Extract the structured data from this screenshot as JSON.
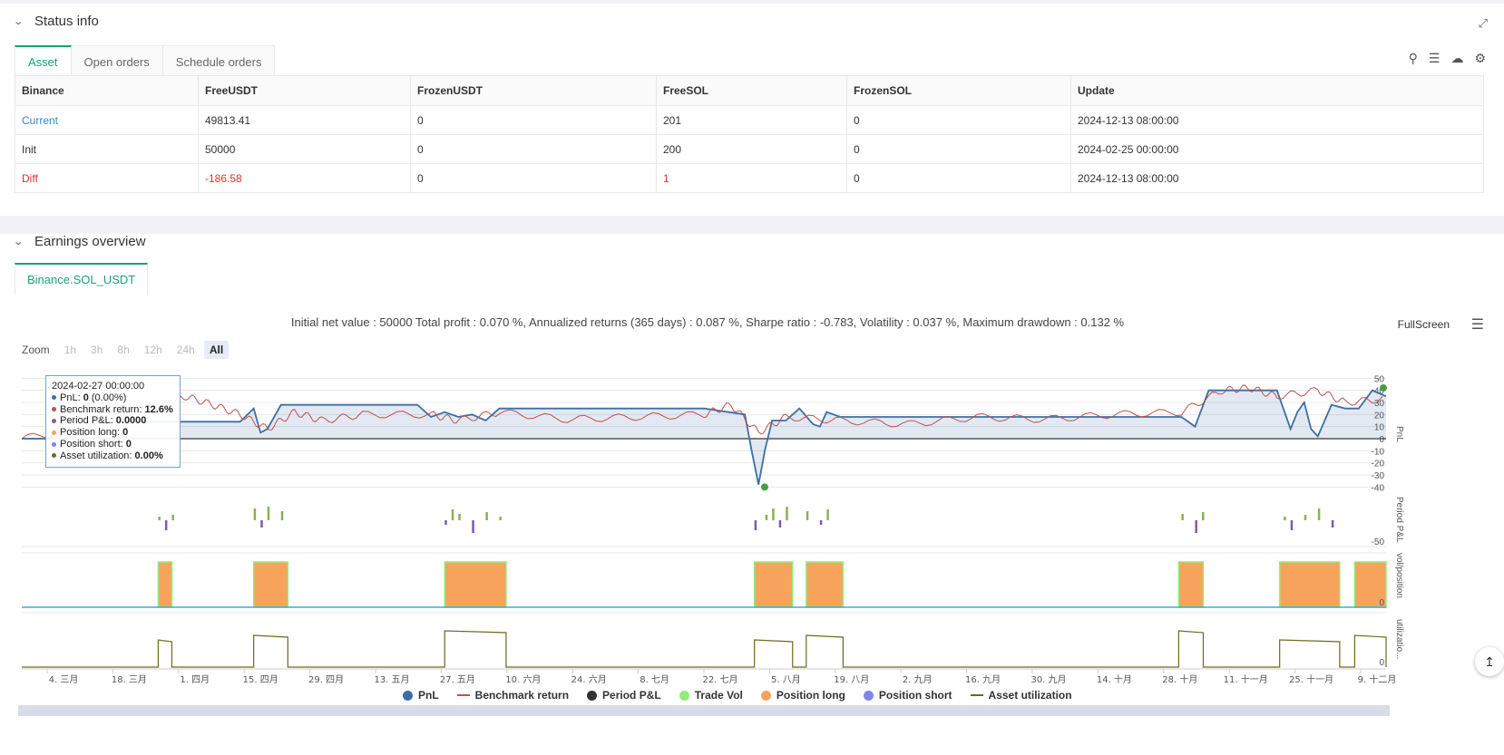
{
  "status": {
    "title": "Status info",
    "tabs": [
      "Asset",
      "Open orders",
      "Schedule orders"
    ],
    "columns": [
      "Binance",
      "FreeUSDT",
      "FrozenUSDT",
      "FreeSOL",
      "FrozenSOL",
      "Update"
    ],
    "rows": [
      {
        "label": "Current",
        "freeusdt": "49813.41",
        "frozenusdt": "0",
        "freesol": "201",
        "frozensol": "0",
        "update": "2024-12-13 08:00:00"
      },
      {
        "label": "Init",
        "freeusdt": "50000",
        "frozenusdt": "0",
        "freesol": "200",
        "frozensol": "0",
        "update": "2024-02-25 00:00:00"
      },
      {
        "label": "Diff",
        "freeusdt": "-186.58",
        "frozenusdt": "0",
        "freesol": "1",
        "frozensol": "0",
        "update": "2024-12-13 08:00:00"
      }
    ]
  },
  "earnings": {
    "title": "Earnings overview",
    "tab": "Binance.SOL_USDT",
    "summary": "Initial net value : 50000 Total profit : 0.070 %, Annualized returns (365 days) : 0.087 %, Sharpe ratio : -0.783, Volatility : 0.037 %, Maximum drawdown : 0.132 %",
    "fullscreen": "FullScreen",
    "zoom_label": "Zoom",
    "zoom_buttons": [
      "1h",
      "3h",
      "8h",
      "12h",
      "24h",
      "All"
    ],
    "tooltip": {
      "date": "2024-02-27 00:00:00",
      "pnl_label": "PnL: ",
      "pnl_value": "0",
      "pnl_extra": " (0.00%)",
      "bench_label": "Benchmark return: ",
      "bench_value": "12.6%",
      "period_label": "Period P&L: ",
      "period_value": "0.0000",
      "long_label": "Position long: ",
      "long_value": "0",
      "short_label": "Position short: ",
      "short_value": "0",
      "util_label": "Asset utilization: ",
      "util_value": "0.00%"
    },
    "legend": [
      "PnL",
      "Benchmark return",
      "Period P&L",
      "Trade Vol",
      "Position long",
      "Position short",
      "Asset utilization"
    ],
    "colors": {
      "pnl": "#3d6ea5",
      "benchmark": "#c0504d",
      "period": "#333333",
      "trade_vol": "#90ed7d",
      "pos_long": "#f7a35c",
      "pos_short": "#8085e9",
      "util": "#6b6b1f",
      "accent": "#1aa07a"
    }
  },
  "chart_data": {
    "type": "line",
    "x_ticks": [
      "4. 三月",
      "18. 三月",
      "1. 四月",
      "15. 四月",
      "29. 四月",
      "13. 五月",
      "27. 五月",
      "10. 六月",
      "24. 六月",
      "8. 七月",
      "22. 七月",
      "5. 八月",
      "19. 八月",
      "2. 九月",
      "16. 九月",
      "30. 九月",
      "14. 十月",
      "28. 十月",
      "11. 十一月",
      "25. 十一月",
      "9. 十二月"
    ],
    "pnl_axis_ticks": [
      "50",
      "40",
      "30",
      "20",
      "10",
      "0",
      "-10",
      "-20",
      "-30",
      "-40"
    ],
    "pnl_axis_label": "PnL",
    "period_axis_label": "Period P&L",
    "period_axis_ticks": [
      "-50"
    ],
    "pos_axis_label": "vol/position",
    "pos_axis_ticks": [
      "0"
    ],
    "util_axis_label": "utilizatio...",
    "util_axis_ticks": [
      "0"
    ],
    "pnl": [
      [
        0,
        0
      ],
      [
        0.02,
        0
      ],
      [
        0.03,
        14
      ],
      [
        0.08,
        14
      ],
      [
        0.16,
        14
      ],
      [
        0.17,
        25
      ],
      [
        0.175,
        5
      ],
      [
        0.18,
        8
      ],
      [
        0.19,
        28
      ],
      [
        0.29,
        28
      ],
      [
        0.3,
        18
      ],
      [
        0.31,
        22
      ],
      [
        0.32,
        18
      ],
      [
        0.33,
        20
      ],
      [
        0.34,
        15
      ],
      [
        0.35,
        25
      ],
      [
        0.5,
        25
      ],
      [
        0.53,
        20
      ],
      [
        0.535,
        -10
      ],
      [
        0.54,
        -38
      ],
      [
        0.545,
        -8
      ],
      [
        0.55,
        15
      ],
      [
        0.56,
        15
      ],
      [
        0.57,
        25
      ],
      [
        0.58,
        12
      ],
      [
        0.585,
        10
      ],
      [
        0.59,
        22
      ],
      [
        0.6,
        18
      ],
      [
        0.85,
        18
      ],
      [
        0.86,
        10
      ],
      [
        0.87,
        40
      ],
      [
        0.92,
        40
      ],
      [
        0.93,
        8
      ],
      [
        0.935,
        22
      ],
      [
        0.94,
        30
      ],
      [
        0.945,
        8
      ],
      [
        0.95,
        2
      ],
      [
        0.96,
        28
      ],
      [
        0.97,
        25
      ],
      [
        0.98,
        25
      ],
      [
        0.99,
        40
      ],
      [
        1,
        35
      ]
    ],
    "benchmark": [
      [
        0,
        0
      ],
      [
        0.05,
        10
      ],
      [
        0.1,
        25
      ],
      [
        0.12,
        35
      ],
      [
        0.14,
        28
      ],
      [
        0.16,
        20
      ],
      [
        0.18,
        8
      ],
      [
        0.2,
        22
      ],
      [
        0.22,
        15
      ],
      [
        0.25,
        20
      ],
      [
        0.3,
        20
      ],
      [
        0.32,
        15
      ],
      [
        0.35,
        22
      ],
      [
        0.4,
        16
      ],
      [
        0.45,
        18
      ],
      [
        0.5,
        20
      ],
      [
        0.52,
        28
      ],
      [
        0.54,
        5
      ],
      [
        0.56,
        18
      ],
      [
        0.6,
        15
      ],
      [
        0.65,
        12
      ],
      [
        0.7,
        18
      ],
      [
        0.75,
        16
      ],
      [
        0.8,
        20
      ],
      [
        0.85,
        22
      ],
      [
        0.88,
        40
      ],
      [
        0.9,
        42
      ],
      [
        0.92,
        35
      ],
      [
        0.95,
        40
      ],
      [
        0.97,
        30
      ],
      [
        1,
        33
      ]
    ],
    "position_long_blocks": [
      [
        0.1,
        0.11
      ],
      [
        0.17,
        0.195
      ],
      [
        0.31,
        0.355
      ],
      [
        0.537,
        0.565
      ],
      [
        0.575,
        0.602
      ],
      [
        0.848,
        0.866
      ],
      [
        0.922,
        0.966
      ],
      [
        0.977,
        1
      ]
    ],
    "period_pnl_bars": [
      0.1,
      0.105,
      0.11,
      0.17,
      0.175,
      0.18,
      0.19,
      0.31,
      0.315,
      0.32,
      0.33,
      0.34,
      0.35,
      0.537,
      0.545,
      0.55,
      0.555,
      0.56,
      0.575,
      0.585,
      0.59,
      0.85,
      0.86,
      0.865,
      0.925,
      0.93,
      0.94,
      0.95,
      0.96
    ]
  }
}
